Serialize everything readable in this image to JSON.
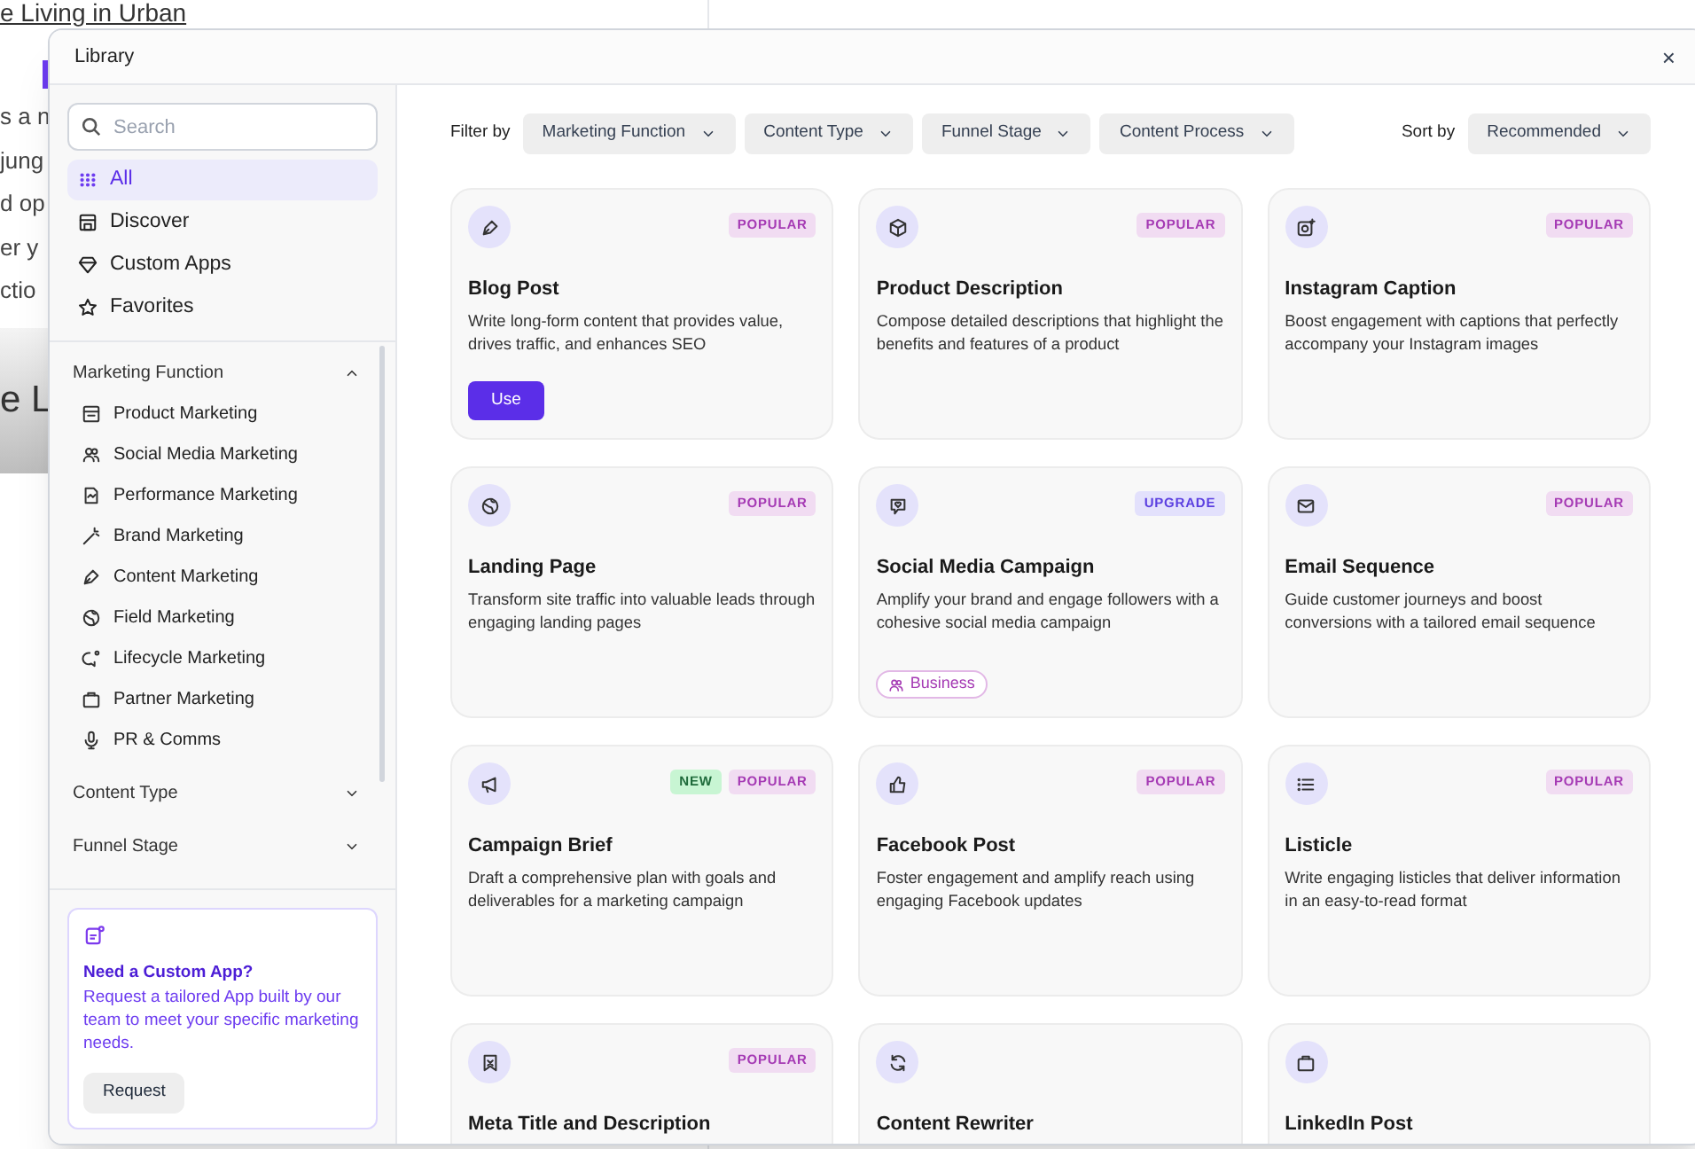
{
  "background_page": {
    "heading": "e Living in Urban",
    "paragraph_lines": [
      "s a n",
      "jung",
      "d op",
      "er y",
      "ctio"
    ],
    "banner_text": "e L"
  },
  "dialog": {
    "title": "Library",
    "close": "×"
  },
  "sidebar": {
    "search": {
      "placeholder": "Search"
    },
    "nav": [
      {
        "label": "All",
        "selected": true
      },
      {
        "label": "Discover",
        "selected": false
      },
      {
        "label": "Custom Apps",
        "selected": false
      },
      {
        "label": "Favorites",
        "selected": false
      }
    ],
    "sections": [
      {
        "label": "Marketing Function",
        "expanded": true,
        "items": [
          "Product Marketing",
          "Social Media Marketing",
          "Performance Marketing",
          "Brand Marketing",
          "Content Marketing",
          "Field Marketing",
          "Lifecycle Marketing",
          "Partner Marketing",
          "PR & Comms"
        ]
      },
      {
        "label": "Content Type",
        "expanded": false
      },
      {
        "label": "Funnel Stage",
        "expanded": false
      }
    ],
    "promo": {
      "title": "Need a Custom App?",
      "text": "Request a tailored App built by our team to meet your specific marketing needs.",
      "button": "Request"
    }
  },
  "filters": {
    "label": "Filter by",
    "options": [
      "Marketing Function",
      "Content Type",
      "Funnel Stage",
      "Content Process"
    ],
    "sort_label": "Sort by",
    "sort_value": "Recommended"
  },
  "cards": [
    {
      "title": "Blog Post",
      "description": "Write long-form content that provides value, drives traffic, and enhances SEO",
      "badges": [
        {
          "kind": "popular",
          "label": "POPULAR"
        }
      ],
      "button": "Use"
    },
    {
      "title": "Product Description",
      "description": "Compose detailed descriptions that highlight the benefits and features of a product",
      "badges": [
        {
          "kind": "popular",
          "label": "POPULAR"
        }
      ]
    },
    {
      "title": "Instagram Caption",
      "description": "Boost engagement with captions that perfectly accompany your Instagram images",
      "badges": [
        {
          "kind": "popular",
          "label": "POPULAR"
        }
      ]
    },
    {
      "title": "Landing Page",
      "description": "Transform site traffic into valuable leads through engaging landing pages",
      "badges": [
        {
          "kind": "popular",
          "label": "POPULAR"
        }
      ]
    },
    {
      "title": "Social Media Campaign",
      "description": "Amplify your brand and engage followers with a cohesive social media campaign",
      "badges": [
        {
          "kind": "upgrade",
          "label": "UPGRADE"
        }
      ],
      "tag": "Business"
    },
    {
      "title": "Email Sequence",
      "description": "Guide customer journeys and boost conversions with a tailored email sequence",
      "badges": [
        {
          "kind": "popular",
          "label": "POPULAR"
        }
      ]
    },
    {
      "title": "Campaign Brief",
      "description": "Draft a comprehensive plan with goals and deliverables for a marketing campaign",
      "badges": [
        {
          "kind": "new",
          "label": "NEW"
        },
        {
          "kind": "popular",
          "label": "POPULAR"
        }
      ]
    },
    {
      "title": "Facebook Post",
      "description": "Foster engagement and amplify reach using engaging Facebook updates",
      "badges": [
        {
          "kind": "popular",
          "label": "POPULAR"
        }
      ]
    },
    {
      "title": "Listicle",
      "description": "Write engaging listicles that deliver information in an easy-to-read format",
      "badges": [
        {
          "kind": "popular",
          "label": "POPULAR"
        }
      ]
    },
    {
      "title": "Meta Title and Description",
      "badges": [
        {
          "kind": "popular",
          "label": "POPULAR"
        }
      ]
    },
    {
      "title": "Content Rewriter"
    },
    {
      "title": "LinkedIn Post"
    }
  ]
}
